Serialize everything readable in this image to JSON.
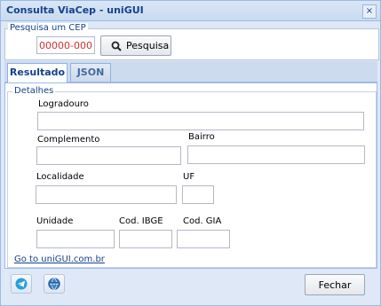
{
  "window": {
    "title": "Consulta ViaCep - uniGUI",
    "close_glyph": "×"
  },
  "search": {
    "legend": "Pesquisa um CEP",
    "cep_mask": "00000-000",
    "button_label": "Pesquisa",
    "button_icon": "search-icon"
  },
  "tabs": [
    {
      "label": "Resultado",
      "active": true
    },
    {
      "label": "JSON",
      "active": false
    }
  ],
  "details": {
    "legend": "Detalhes",
    "fields": {
      "logradouro": {
        "label": "Logradouro",
        "value": ""
      },
      "complemento": {
        "label": "Complemento",
        "value": ""
      },
      "bairro": {
        "label": "Bairro",
        "value": ""
      },
      "localidade": {
        "label": "Localidade",
        "value": ""
      },
      "uf": {
        "label": "UF",
        "value": ""
      },
      "unidade": {
        "label": "Unidade",
        "value": ""
      },
      "ibge": {
        "label": "Cod. IBGE",
        "value": ""
      },
      "gia": {
        "label": "Cod. GIA",
        "value": ""
      }
    }
  },
  "link_text": "Go to uniGUI.com.br",
  "footer": {
    "icons": [
      "telegram-icon",
      "globe-www-icon"
    ],
    "close_label": "Fechar"
  },
  "colors": {
    "header_text": "#15428b",
    "border": "#99bbe8",
    "cep_mask": "#cc3333"
  }
}
